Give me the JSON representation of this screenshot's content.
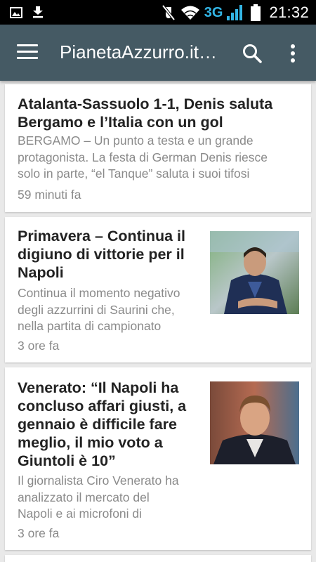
{
  "status_bar": {
    "time": "21:32",
    "network": "3G",
    "icons": [
      "image-icon",
      "download-icon",
      "mute-icon",
      "wifi-icon",
      "signal-icon",
      "battery-icon"
    ]
  },
  "app_bar": {
    "title": "PianetaAzzurro.it…",
    "color": "#455a64",
    "icons": [
      "menu-icon",
      "search-icon",
      "more-vert-icon"
    ]
  },
  "articles": [
    {
      "title_lines": [
        "Atalanta-Sassuolo 1-1, Denis saluta",
        "Bergamo e l’Italia con un gol"
      ],
      "excerpt_lines": [
        "BERGAMO – Un punto a testa e un grande",
        "protagonista. La festa di German Denis riesce",
        "solo in parte, “el Tanque” saluta i suoi tifosi"
      ],
      "time": "59 minuti fa"
    },
    {
      "title_lines": [
        "Primavera – Continua il",
        "digiuno di vittorie per il",
        "Napoli"
      ],
      "excerpt_lines": [
        "Continua il momento negativo",
        "degli azzurrini di Saurini che,",
        "nella partita di campionato"
      ],
      "time": "3 ore fa",
      "thumbnail": "coach-photo"
    },
    {
      "title_lines": [
        "Venerato: “Il Napoli ha",
        "concluso affari giusti, a",
        "gennaio è difficile fare",
        "meglio, il mio voto a",
        "Giuntoli è 10”"
      ],
      "excerpt_lines": [
        "Il giornalista Ciro Venerato  ha",
        "analizzato il mercato del",
        "Napoli e ai microfoni di"
      ],
      "time": "3 ore fa",
      "thumbnail": "journalist-photo"
    }
  ]
}
